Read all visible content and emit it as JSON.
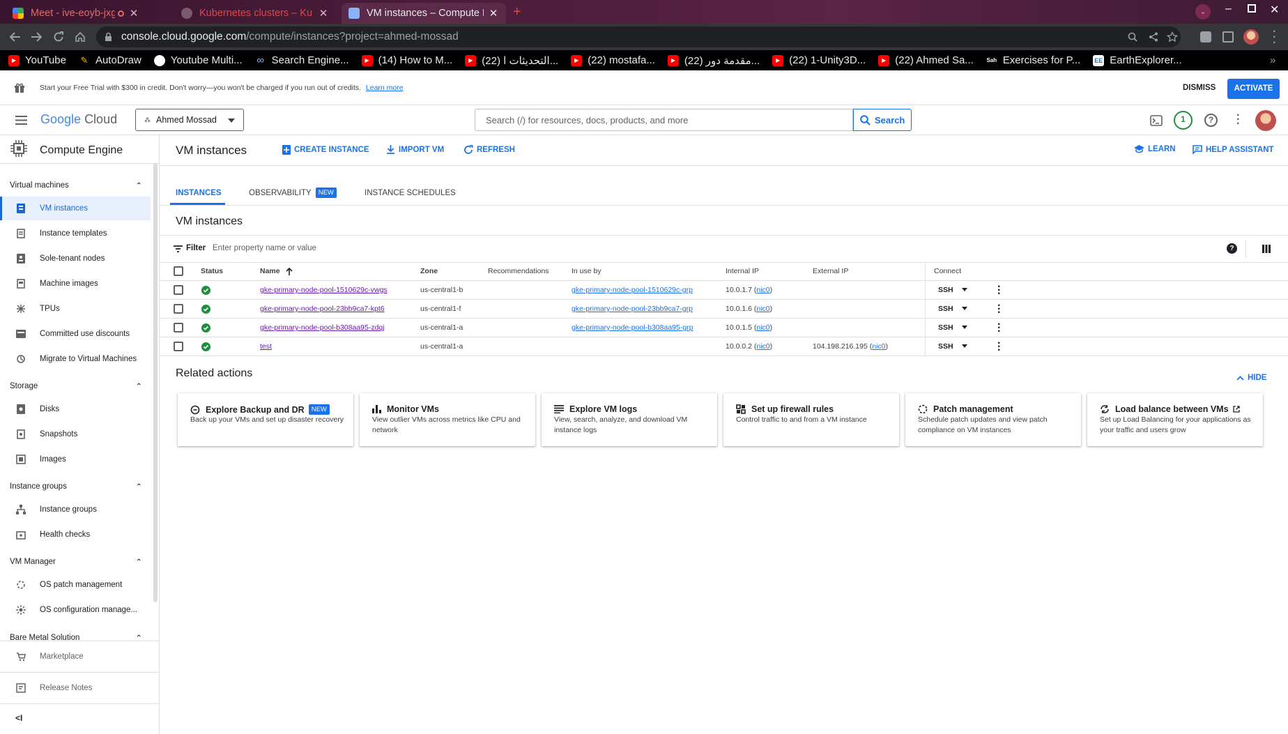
{
  "browser": {
    "tabs": [
      {
        "title": "Meet - ive-eoyb-jxg",
        "color": "#e06a6a"
      },
      {
        "title": "Kubernetes clusters – Ku",
        "color": "#d84a4a"
      },
      {
        "title": "VM instances – Compute E",
        "color": "#e8eaed"
      }
    ],
    "new_tab_label": "+",
    "url_host": "console.cloud.google.com",
    "url_path": "/compute/instances?project=ahmed-mossad",
    "bookmarks": [
      "YouTube",
      "AutoDraw",
      "Youtube Multi...",
      "Search Engine...",
      "(14) How to M...",
      "(22) التحديثات ا...",
      "(22) mostafa...",
      "(22) مقدمة دور...",
      "(22) 1-Unity3D...",
      "(22) Ahmed Sa...",
      "Exercises for P...",
      "EarthExplorer..."
    ],
    "bookmarks_overflow": "»"
  },
  "trial_banner": {
    "text": "Start your Free Trial with $300 in credit. Don't worry—you won't be charged if you run out of credits.",
    "learn_more": "Learn more",
    "dismiss": "DISMISS",
    "activate": "ACTIVATE"
  },
  "topbar": {
    "logo_google": "Google",
    "logo_cloud": "Cloud",
    "project": "Ahmed Mossad",
    "search_placeholder": "Search (/) for resources, docs, products, and more",
    "search_button": "Search",
    "notifications_count": "1"
  },
  "sidebar": {
    "product": "Compute Engine",
    "sections": [
      {
        "title": "Virtual machines",
        "items": [
          "VM instances",
          "Instance templates",
          "Sole-tenant nodes",
          "Machine images",
          "TPUs",
          "Committed use discounts",
          "Migrate to Virtual Machines"
        ]
      },
      {
        "title": "Storage",
        "items": [
          "Disks",
          "Snapshots",
          "Images"
        ]
      },
      {
        "title": "Instance groups",
        "items": [
          "Instance groups",
          "Health checks"
        ]
      },
      {
        "title": "VM Manager",
        "items": [
          "OS patch management",
          "OS configuration manage..."
        ]
      },
      {
        "title": "Bare Metal Solution",
        "items": []
      }
    ],
    "footer_items": [
      "Marketplace",
      "Release Notes"
    ],
    "collapse_label": "<I"
  },
  "page": {
    "title": "VM instances",
    "actions": {
      "create": "CREATE INSTANCE",
      "import": "IMPORT VM",
      "refresh": "REFRESH",
      "learn": "LEARN",
      "help": "HELP ASSISTANT"
    },
    "tabs": {
      "instances": "INSTANCES",
      "observability": "OBSERVABILITY",
      "observability_badge": "NEW",
      "schedules": "INSTANCE SCHEDULES"
    },
    "section_title": "VM instances",
    "filter_label": "Filter",
    "filter_placeholder": "Enter property name or value"
  },
  "table": {
    "headers": {
      "status": "Status",
      "name": "Name",
      "zone": "Zone",
      "recommendations": "Recommendations",
      "in_use_by": "In use by",
      "internal_ip": "Internal IP",
      "external_ip": "External IP",
      "connect": "Connect"
    },
    "rows": [
      {
        "name": "gke-primary-node-pool-1510629c-vwgs",
        "zone": "us-central1-b",
        "in_use_by": "gke-primary-node-pool-1510629c-grp",
        "internal_ip": "10.0.1.7",
        "internal_nic": "nic0",
        "external_ip": "",
        "external_nic": "",
        "connect": "SSH"
      },
      {
        "name": "gke-primary-node-pool-23bb9ca7-kpt6",
        "zone": "us-central1-f",
        "in_use_by": "gke-primary-node-pool-23bb9ca7-grp",
        "internal_ip": "10.0.1.6",
        "internal_nic": "nic0",
        "external_ip": "",
        "external_nic": "",
        "connect": "SSH"
      },
      {
        "name": "gke-primary-node-pool-b308aa95-zdqj",
        "zone": "us-central1-a",
        "in_use_by": "gke-primary-node-pool-b308aa95-grp",
        "internal_ip": "10.0.1.5",
        "internal_nic": "nic0",
        "external_ip": "",
        "external_nic": "",
        "connect": "SSH"
      },
      {
        "name": "test",
        "zone": "us-central1-a",
        "in_use_by": "",
        "internal_ip": "10.0.0.2",
        "internal_nic": "nic0",
        "external_ip": "104.198.216.195",
        "external_nic": "nic0",
        "connect": "SSH"
      }
    ]
  },
  "related": {
    "title": "Related actions",
    "hide": "HIDE",
    "cards": [
      {
        "title": "Explore Backup and DR",
        "badge": "NEW",
        "desc": "Back up your VMs and set up disaster recovery"
      },
      {
        "title": "Monitor VMs",
        "badge": "",
        "desc": "View outlier VMs across metrics like CPU and network"
      },
      {
        "title": "Explore VM logs",
        "badge": "",
        "desc": "View, search, analyze, and download VM instance logs"
      },
      {
        "title": "Set up firewall rules",
        "badge": "",
        "desc": "Control traffic to and from a VM instance"
      },
      {
        "title": "Patch management",
        "badge": "",
        "desc": "Schedule patch updates and view patch compliance on VM instances"
      },
      {
        "title": "Load balance between VMs",
        "badge": "",
        "desc": "Set up Load Balancing for your applications as your traffic and users grow"
      }
    ]
  },
  "colors": {
    "accent": "#1a73e8",
    "status_ok": "#1e8e3e",
    "visited_link": "#681da8"
  }
}
